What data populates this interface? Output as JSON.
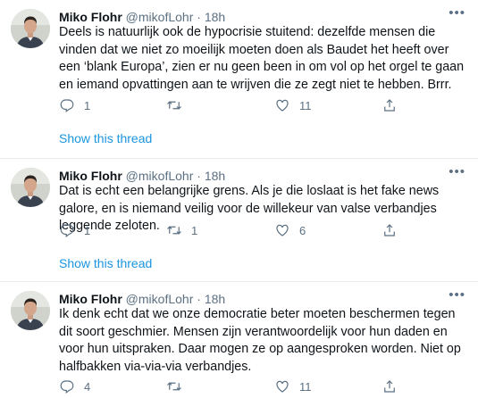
{
  "tweets": [
    {
      "name": "Miko Flohr",
      "handle": "@mikofLohr",
      "sep": "·",
      "time": "18h",
      "more": "•••",
      "text": "Deels is natuurlijk ook de hypocrisie stuitend: dezelfde mensen die vinden dat we niet zo moeilijk moeten doen als Baudet het heeft over een ‘blank Europa’, zien er nu geen been in om vol op het orgel te gaan en iemand opvattingen aan te wrijven die ze zegt niet te hebben. Brrr.",
      "replies": "1",
      "retweets": "",
      "likes": "11",
      "show_thread": "Show this thread"
    },
    {
      "name": "Miko Flohr",
      "handle": "@mikofLohr",
      "sep": "·",
      "time": "18h",
      "more": "•••",
      "text": "Dat is echt een belangrijke grens. Als je die loslaat is het fake news galore, en is niemand veilig voor de willekeur van valse verbandjes leggende zeloten.",
      "replies": "1",
      "retweets": "1",
      "likes": "6",
      "show_thread": "Show this thread"
    },
    {
      "name": "Miko Flohr",
      "handle": "@mikofLohr",
      "sep": "·",
      "time": "18h",
      "more": "•••",
      "text": "Ik denk echt dat we onze democratie beter moeten beschermen tegen dit soort geschmier. Mensen zijn verantwoordelijk voor hun daden en voor hun uitspraken. Daar mogen ze op aangesproken worden. Niet op halfbakken via-via-via verbandjes.",
      "replies": "4",
      "retweets": "",
      "likes": "11",
      "show_thread": ""
    }
  ],
  "icons": {
    "reply": "reply-icon",
    "retweet": "retweet-icon",
    "like": "heart-icon",
    "share": "share-icon",
    "more": "more-icon"
  },
  "colors": {
    "link": "#1b95e0",
    "muted": "#5b7083",
    "divider": "#e6ecf0"
  }
}
